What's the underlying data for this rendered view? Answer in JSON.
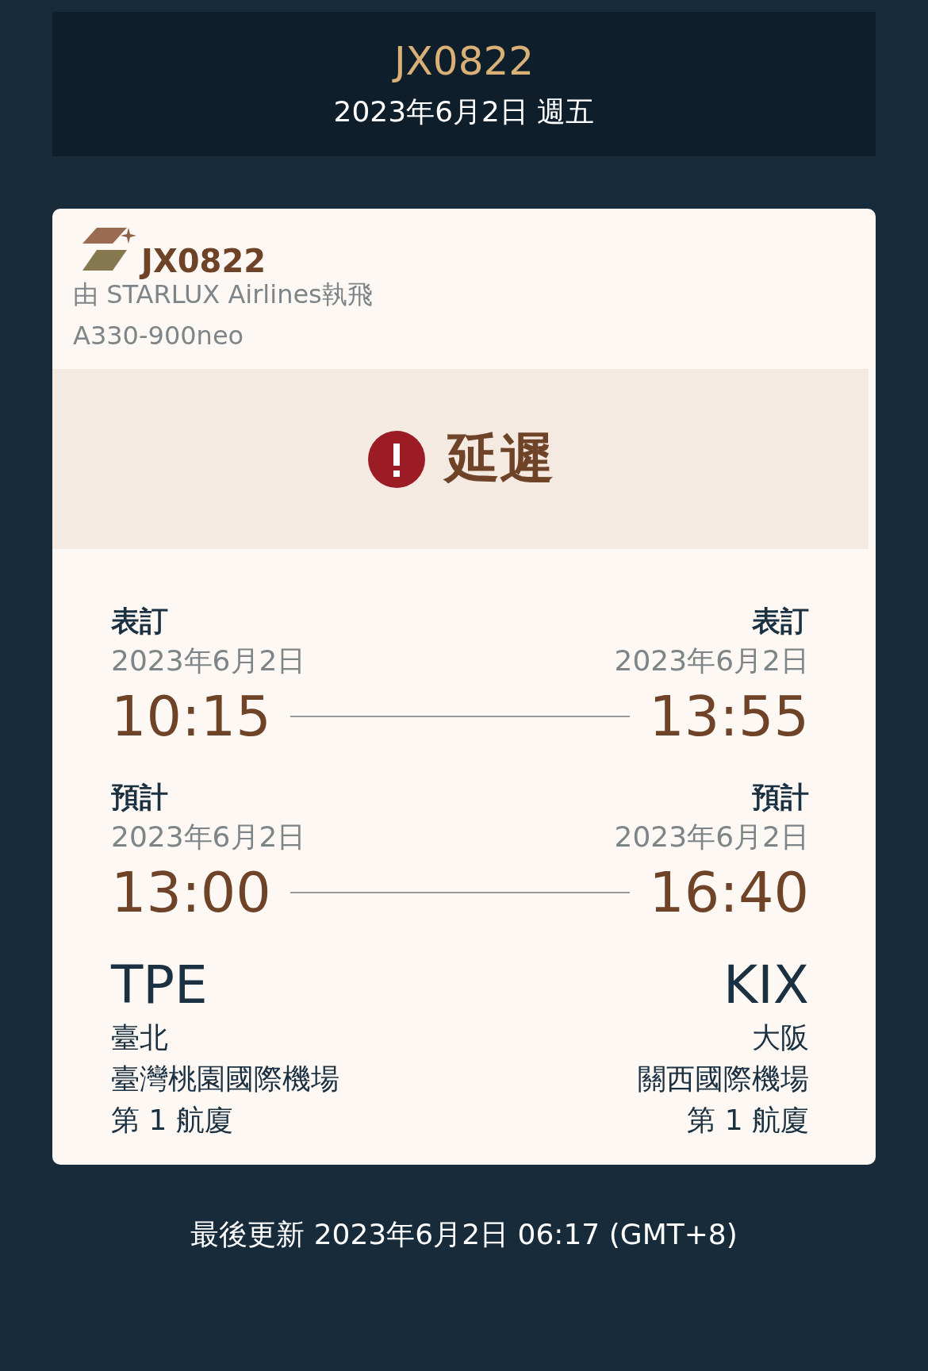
{
  "header": {
    "flight": "JX0822",
    "date": "2023年6月2日 週五"
  },
  "card": {
    "flight": "JX0822",
    "operator": "由 STARLUX Airlines執飛",
    "aircraft": "A330-900neo"
  },
  "status": {
    "kind": "delayed",
    "label": "延遲"
  },
  "times": [
    {
      "label_left": "表訂",
      "date_left": "2023年6月2日",
      "time_left": "10:15",
      "label_right": "表訂",
      "date_right": "2023年6月2日",
      "time_right": "13:55"
    },
    {
      "label_left": "預計",
      "date_left": "2023年6月2日",
      "time_left": "13:00",
      "label_right": "預計",
      "date_right": "2023年6月2日",
      "time_right": "16:40"
    }
  ],
  "origin": {
    "code": "TPE",
    "city": "臺北",
    "airport": "臺灣桃園國際機場",
    "terminal": "第 1 航廈"
  },
  "destination": {
    "code": "KIX",
    "city": "大阪",
    "airport": "關西國際機場",
    "terminal": "第 1 航廈"
  },
  "footer": "最後更新 2023年6月2日 06:17 (GMT+8)"
}
